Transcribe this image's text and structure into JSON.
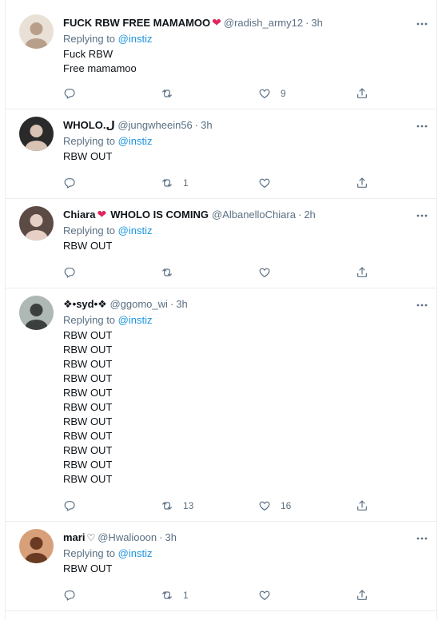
{
  "tweets": [
    {
      "display_name": "FUCK RBW FREE MAMAMOO",
      "emoji": "❤",
      "handle": "@radish_army12",
      "time": "3h",
      "replying_label": "Replying to",
      "mention": "@instiz",
      "lines": [
        "Fuck RBW",
        "Free mamamoo"
      ],
      "reply_count": "",
      "retweet_count": "",
      "like_count": "9",
      "avatar_colors": [
        "#e9e1d6",
        "#b89f8a"
      ]
    },
    {
      "display_name": "WHOLO.ل",
      "emoji": "",
      "handle": "@jungwheein56",
      "time": "3h",
      "replying_label": "Replying to",
      "mention": "@instiz",
      "lines": [
        "RBW OUT"
      ],
      "reply_count": "",
      "retweet_count": "1",
      "like_count": "",
      "avatar_colors": [
        "#2a2a2a",
        "#d9c3b4"
      ]
    },
    {
      "display_name": "Chiara",
      "emoji": "❤",
      "display_name_suffix": "WHOLO IS COMING",
      "handle": "@AlbanelloChiara",
      "time": "2h",
      "replying_label": "Replying to",
      "mention": "@instiz",
      "lines": [
        "RBW OUT"
      ],
      "reply_count": "",
      "retweet_count": "",
      "like_count": "",
      "avatar_colors": [
        "#5c4a45",
        "#e6cfc4"
      ]
    },
    {
      "display_name": "❖•syd•❖",
      "emoji": "",
      "handle": "@ggomo_wi",
      "time": "3h",
      "replying_label": "Replying to",
      "mention": "@instiz",
      "lines": [
        "RBW OUT",
        "RBW OUT",
        "RBW OUT",
        "RBW OUT",
        "RBW OUT",
        "RBW OUT",
        "RBW OUT",
        "RBW OUT",
        "RBW OUT",
        "RBW OUT",
        "RBW OUT"
      ],
      "reply_count": "",
      "retweet_count": "13",
      "like_count": "16",
      "avatar_colors": [
        "#aeb8b4",
        "#3b3f3d"
      ]
    },
    {
      "display_name": "mari",
      "emoji": "♡",
      "handle": "@Hwaliooon",
      "time": "3h",
      "replying_label": "Replying to",
      "mention": "@instiz",
      "lines": [
        "RBW OUT"
      ],
      "reply_count": "",
      "retweet_count": "1",
      "like_count": "",
      "avatar_colors": [
        "#d8a07a",
        "#6b3a22"
      ]
    }
  ],
  "separator": "·",
  "colors": {
    "text": "#0f1419",
    "muted": "#5b7083",
    "link": "#1b95e0",
    "heart": "#e0245e",
    "border": "#ebeef0"
  },
  "icons": {
    "reply": "reply-icon",
    "retweet": "retweet-icon",
    "like": "like-icon",
    "share": "share-icon",
    "more": "more-icon"
  }
}
